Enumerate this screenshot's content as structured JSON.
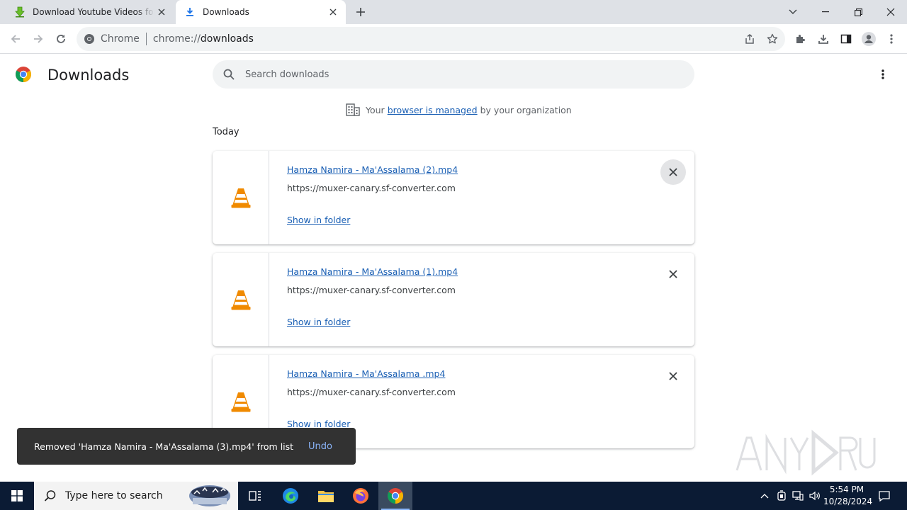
{
  "browser": {
    "tabs": [
      {
        "title": "Download Youtube Videos for Free",
        "active": false,
        "favicon": "green-download-arrow-icon"
      },
      {
        "title": "Downloads",
        "active": true,
        "favicon": "download-icon"
      }
    ],
    "omnibox": {
      "site_label": "Chrome",
      "url_scheme": "chrome://",
      "url_host": "downloads"
    }
  },
  "page": {
    "title": "Downloads",
    "search_placeholder": "Search downloads",
    "managed_notice": {
      "prefix": "Your",
      "link": "browser is managed",
      "suffix": "by your organization"
    },
    "section_date": "Today",
    "downloads": [
      {
        "filename": "Hamza Namira - Ma'Assalama (2).mp4",
        "url": "https://muxer-canary.sf-converter.com",
        "action": "Show in folder"
      },
      {
        "filename": "Hamza Namira - Ma'Assalama (1).mp4",
        "url": "https://muxer-canary.sf-converter.com",
        "action": "Show in folder"
      },
      {
        "filename": "Hamza Namira - Ma'Assalama .mp4",
        "url": "https://muxer-canary.sf-converter.com",
        "action": "Show in folder"
      }
    ]
  },
  "toast": {
    "message": "Removed 'Hamza Namira - Ma'Assalama  (3).mp4' from list",
    "action": "Undo"
  },
  "taskbar": {
    "search_placeholder": "Type here to search",
    "time": "5:54 PM",
    "date": "10/28/2024"
  },
  "colors": {
    "link": "#1a5fb4",
    "tabstrip": "#dee1e6",
    "toast_bg": "#323232",
    "taskbar": "#0b1b34"
  }
}
